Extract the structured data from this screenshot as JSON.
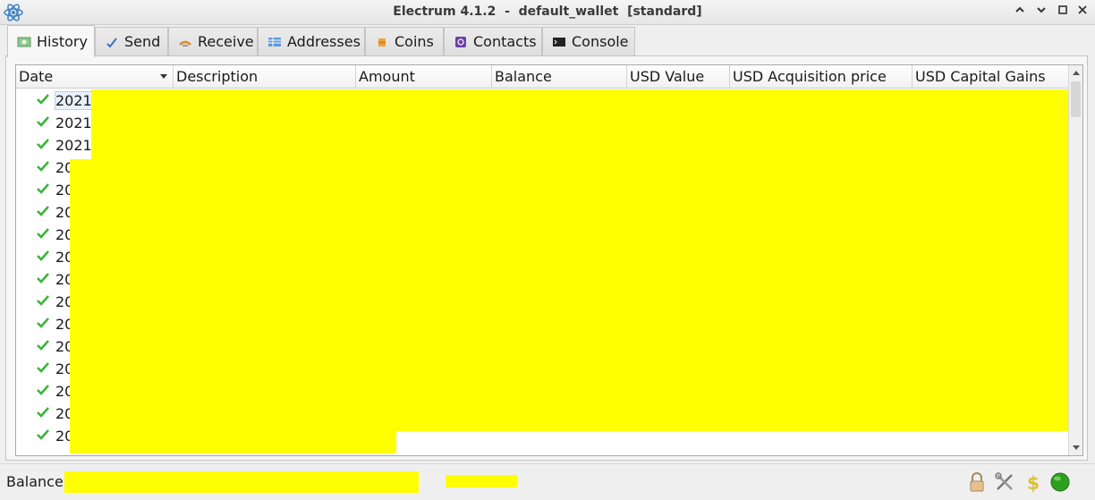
{
  "window": {
    "title": "Electrum 4.1.2  -  default_wallet  [standard]",
    "minimize_glyph": "⌃",
    "restore_glyph": "⌃",
    "maximize_glyph": "□",
    "close_glyph": "✕"
  },
  "tabs": [
    {
      "label": "History",
      "icon": "history-icon",
      "active": true
    },
    {
      "label": "Send",
      "icon": "send-icon"
    },
    {
      "label": "Receive",
      "icon": "receive-icon"
    },
    {
      "label": "Addresses",
      "icon": "addresses-icon"
    },
    {
      "label": "Coins",
      "icon": "coins-icon"
    },
    {
      "label": "Contacts",
      "icon": "contacts-icon"
    },
    {
      "label": "Console",
      "icon": "console-icon"
    }
  ],
  "history_table": {
    "columns": [
      "Date",
      "Description",
      "Amount",
      "Balance",
      "USD Value",
      "USD Acquisition price",
      "USD Capital Gains"
    ],
    "rows": [
      {
        "date": "2021-"
      },
      {
        "date": "2021-"
      },
      {
        "date": "2021-"
      },
      {
        "date": "20"
      },
      {
        "date": "20"
      },
      {
        "date": "20"
      },
      {
        "date": "20"
      },
      {
        "date": "20"
      },
      {
        "date": "20"
      },
      {
        "date": "20"
      },
      {
        "date": "20"
      },
      {
        "date": "20"
      },
      {
        "date": "20"
      },
      {
        "date": "20"
      },
      {
        "date": "20"
      },
      {
        "date": "20"
      }
    ]
  },
  "statusbar": {
    "balance_label": "Balance:"
  },
  "colors": {
    "redaction": "#ffff00",
    "check": "#3cb43c",
    "status_green": "#2e9e1e"
  }
}
